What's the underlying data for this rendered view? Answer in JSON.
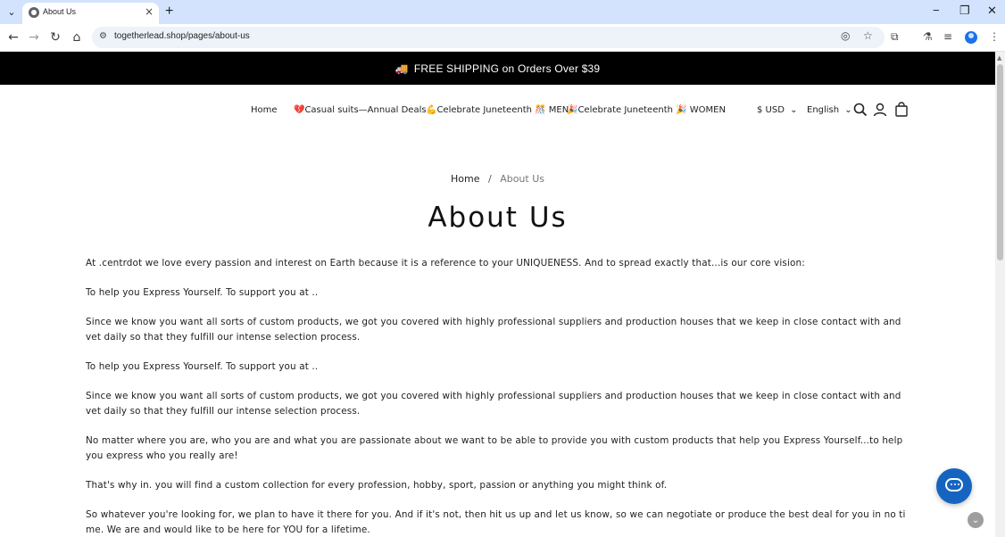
{
  "browser": {
    "tab_title": "About Us",
    "url": "togetherlead.shop/pages/about-us"
  },
  "announcement": {
    "icon": "truck-icon",
    "text": "FREE SHIPPING on Orders Over $39"
  },
  "nav": {
    "items": [
      {
        "label": "Home"
      },
      {
        "label": "💔Casual suits—Annual Deals"
      },
      {
        "label": "💪Celebrate Juneteenth 🎊 MEN"
      },
      {
        "label": "🎉Celebrate Juneteenth 🎉 WOMEN"
      }
    ],
    "currency": "$ USD",
    "language": "English"
  },
  "breadcrumb": {
    "home": "Home",
    "separator": "/",
    "current": "About Us"
  },
  "page_title": "About Us",
  "paragraphs": [
    "At .centrdot we love every passion and interest on Earth because it is a reference to your UNIQUENESS. And to spread exactly that...is our core vision:",
    "To help you Express Yourself. To support you at ..",
    "Since we know you want all sorts of custom products, we got you covered with highly professional suppliers and production houses that we keep in close contact with and vet daily so that they fulfill our intense selection process.",
    "To help you Express Yourself. To support you at ..",
    "Since we know you want all sorts of custom products, we got you covered with highly professional suppliers and production houses that we keep in close contact with and vet daily so that they fulfill our intense selection process.",
    "No matter where you are, who you are and what you are passionate about we want to be able to provide you with custom products that help you Express Yourself...to help you express who you really are!",
    "That's why in. you will find a custom collection for every profession, hobby, sport, passion or anything you might think of.",
    "So whatever you're looking for, we plan to have it there for you. And if it's not, then hit us up and let us know, so we can negotiate or produce the best deal for you in no time. We are and would like to be here for YOU for a lifetime."
  ],
  "colors": {
    "announcement_bg": "#000000",
    "chat_button": "#1565c0",
    "browser_tabstrip": "#d3e3fd"
  }
}
